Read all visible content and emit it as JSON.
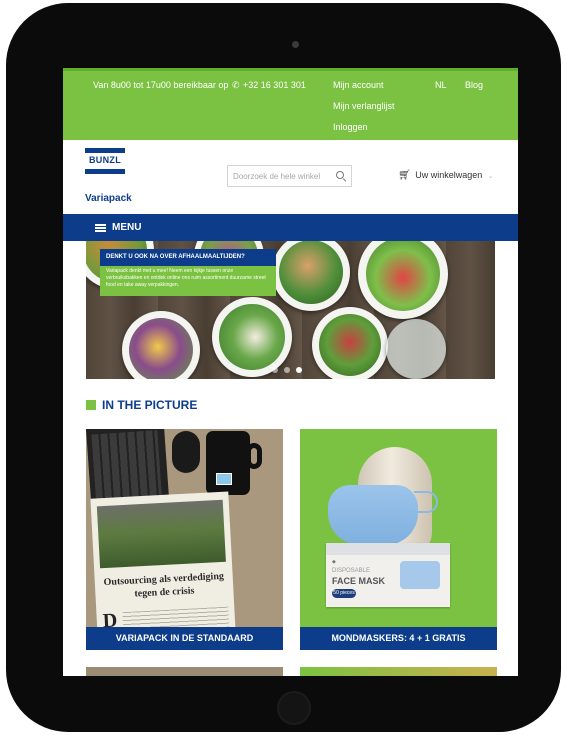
{
  "topbar": {
    "hours_text": "Van 8u00 tot 17u00 bereikbaar op",
    "phone": "+32 16 301 301",
    "links": [
      "Mijn account",
      "Mijn verlanglijst",
      "Inloggen"
    ],
    "language": "NL",
    "blog": "Blog"
  },
  "header": {
    "logo_brand": "BUNZL",
    "logo_sub": "Variapack",
    "search_placeholder": "Doorzoek de hele winkel",
    "cart_label": "Uw winkelwagen"
  },
  "menu": {
    "label": "MENU"
  },
  "banner": {
    "promo_title": "DENKT U OOK NA OVER AFHAALMAALTIJDEN?",
    "promo_body": "Variapack denkt met u mee! Neem een kijkje tussen onze verbruiksbakken en ontdek online ons ruim assortiment duurzame street food en take away verpakkingen.",
    "slide_count": 3,
    "active_slide": 2
  },
  "section": {
    "title": "IN THE PICTURE"
  },
  "cards": [
    {
      "caption": "VARIAPACK IN DE STANDAARD",
      "headline": "Outsourcing als verdediging tegen de crisis"
    },
    {
      "caption": "MONDMASKERS: 4 + 1 GRATIS",
      "box_line1": "DISPOSABLE",
      "box_line2": "FACE MASK",
      "box_count": "50 pieces"
    }
  ],
  "colors": {
    "green": "#7cc242",
    "blue": "#0d3d8a"
  }
}
